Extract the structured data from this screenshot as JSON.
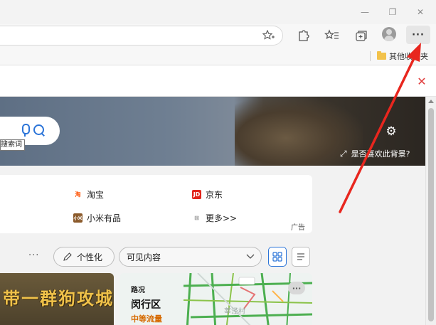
{
  "window": {
    "minimize_glyph": "—",
    "restore_glyph": "❐",
    "close_glyph": "✕"
  },
  "toolbar": {
    "more_label": "···",
    "icons": [
      "favorite-add-icon",
      "extensions-icon",
      "favorites-icon",
      "collections-icon",
      "profile-avatar",
      "more-menu-icon"
    ]
  },
  "bookmarks": {
    "folder_label": "其他收藏夹"
  },
  "notify": {
    "close_glyph": "✕"
  },
  "hero": {
    "search_tooltip": "搜索词",
    "background_question": "是否喜欢此背景?"
  },
  "quick_links": [
    {
      "icon_text": "淘",
      "label": "淘宝",
      "icon_color": "#ff5000"
    },
    {
      "icon_text": "JD",
      "label": "京东",
      "icon_color": "#e1251b"
    },
    {
      "icon_text": "小米",
      "label": "小米有品",
      "icon_color": "#8b5a2b"
    },
    {
      "icon_text": "⊠",
      "label": "更多>>",
      "icon_color": "#999999"
    }
  ],
  "ad_label": "广告",
  "feed_controls": {
    "more_glyph": "···",
    "personalize_label": "个性化",
    "visibility_label": "可见内容"
  },
  "cards": {
    "game_headline": "带一群狗攻城",
    "traffic_title": "路况",
    "traffic_district": "闵行区",
    "traffic_status": "中等流量",
    "map_place": "莘泾村",
    "map_more": "···"
  },
  "colors": {
    "accent_blue": "#2b74d8",
    "arrow_red": "#e8261e",
    "traffic_orange": "#d66a00"
  }
}
